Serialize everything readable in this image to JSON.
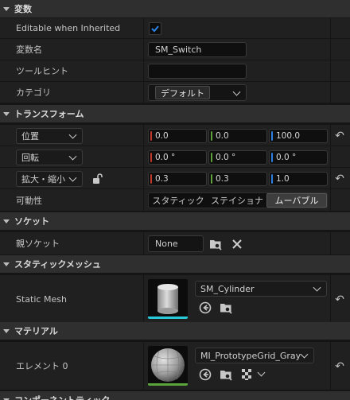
{
  "sections": {
    "variables": "変数",
    "transform": "トランスフォーム",
    "socket": "ソケット",
    "static_mesh": "スタティックメッシュ",
    "material": "マテリアル",
    "component_tick": "コンポーネントティック"
  },
  "variables": {
    "editable_label": "Editable when Inherited",
    "editable_checked": true,
    "var_name_label": "変数名",
    "var_name_value": "SM_Switch",
    "tooltip_label": "ツールヒント",
    "tooltip_value": "",
    "category_label": "カテゴリ",
    "category_value": "デフォルト"
  },
  "transform": {
    "location_label": "位置",
    "location": [
      "0.0",
      "0.0",
      "100.0"
    ],
    "rotation_label": "回転",
    "rotation": [
      "0.0 °",
      "0.0 °",
      "0.0 °"
    ],
    "scale_label": "拡大・縮小",
    "scale": [
      "0.3",
      "0.3",
      "1.0"
    ],
    "mobility_label": "可動性",
    "mobility_options": [
      "スタティック",
      "ステイショナ",
      "ムーバブル"
    ],
    "mobility_selected": "ムーバブル"
  },
  "socket": {
    "parent_label": "親ソケット",
    "parent_value": "None"
  },
  "static_mesh": {
    "label": "Static Mesh",
    "asset": "SM_Cylinder"
  },
  "material": {
    "label": "エレメント 0",
    "asset": "MI_PrototypeGrid_Gray"
  },
  "colors": {
    "x_axis": "#c0392b",
    "y_axis": "#5fa13a",
    "z_axis": "#2f7fe0",
    "mesh_underline": "#28c8d8",
    "material_underline": "#5aa63c",
    "check_blue": "#1f6fd0"
  }
}
